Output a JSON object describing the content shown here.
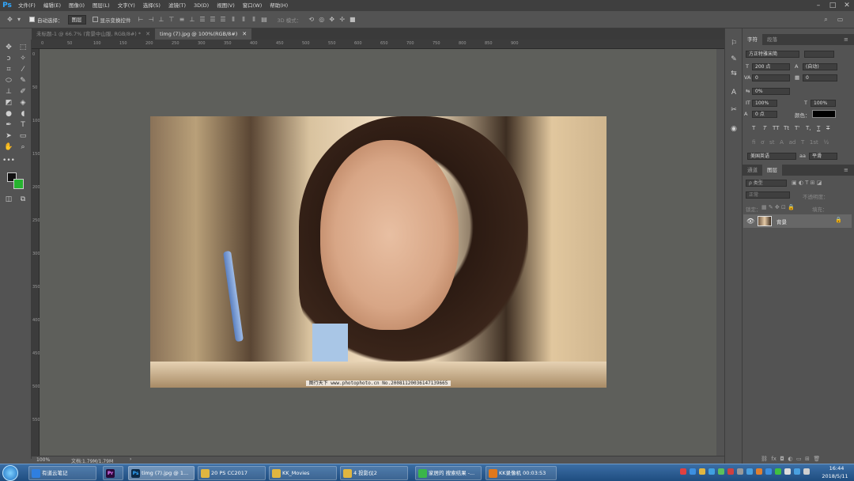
{
  "app": {
    "logo": "Ps",
    "menus": [
      "文件(F)",
      "编辑(E)",
      "图像(I)",
      "图层(L)",
      "文字(Y)",
      "选择(S)",
      "滤镜(T)",
      "3D(D)",
      "视图(V)",
      "窗口(W)",
      "帮助(H)"
    ]
  },
  "options": {
    "auto_select_label": "自动选择：",
    "auto_select_value": "图层",
    "show_transform_label": "显示变换控件",
    "mode_3d_label": "3D 模式："
  },
  "tabs": [
    {
      "label": "未标题-1 @ 66.7% (背景中山服, RGB/8#) *",
      "active": false
    },
    {
      "label": "timg (7).jpg @ 100%(RGB/8#)",
      "active": true
    }
  ],
  "ruler_h_ticks": [
    "0",
    "50",
    "100",
    "150",
    "200",
    "250",
    "300",
    "350",
    "400",
    "450",
    "500",
    "550",
    "600",
    "650",
    "700",
    "750",
    "800",
    "850",
    "900"
  ],
  "ruler_v_ticks": [
    "0",
    "50",
    "100",
    "150",
    "200",
    "250",
    "300",
    "350",
    "400",
    "450",
    "500",
    "550"
  ],
  "document": {
    "watermark": "图行天下 www.photophoto.cn  No.20081120036147139665"
  },
  "status": {
    "zoom": "100%",
    "doc_size": "文档:1.79M/1.79M"
  },
  "char_panel": {
    "tabs": [
      "字符",
      "段落"
    ],
    "font_family": "方正特雅宋简",
    "font_size": "200 点",
    "leading": "(自动)",
    "tracking_va": "0",
    "tracking": "0",
    "scale_pct": "0%",
    "vert_scale": "100%",
    "horiz_scale": "100%",
    "baseline": "0 点",
    "color_label": "颜色：",
    "format_buttons": [
      "T",
      "T",
      "TT",
      "Tt",
      "T'",
      "T,",
      "T",
      "T"
    ],
    "language": "美国英语",
    "anti_alias": "平滑"
  },
  "layers_panel": {
    "tabs": [
      "通道",
      "图层"
    ],
    "filter_label": "ρ 类型",
    "blend_mode": "正常",
    "opacity_label": "不透明度：",
    "lock_label": "锁定：",
    "fill_label": "填充：",
    "layer_name": "背景"
  },
  "taskbar": {
    "items": [
      {
        "label": "有道云笔记",
        "color": "#2f7fe0"
      },
      {
        "label": "",
        "color": "#2a0a3a",
        "badge": "Pr"
      },
      {
        "label": "timg (7).jpg @ 1...",
        "color": "#0b2a48",
        "badge": "Ps",
        "active": true
      },
      {
        "label": "20 PS CC2017",
        "color": "#e0b640"
      },
      {
        "label": "KK_Movies",
        "color": "#e0b640"
      },
      {
        "label": "4 投影仪2",
        "color": "#e0b640"
      },
      {
        "label": "家居的 搜索结果 -...",
        "color": "#3ab54a"
      },
      {
        "label": "KK录像机 00:03:53",
        "color": "#e0781c"
      }
    ],
    "time": "16:44",
    "date": "2018/5/11"
  },
  "colors": {
    "foreground": "#111111",
    "background": "#26b32f",
    "text_color_swatch": "#000000"
  }
}
